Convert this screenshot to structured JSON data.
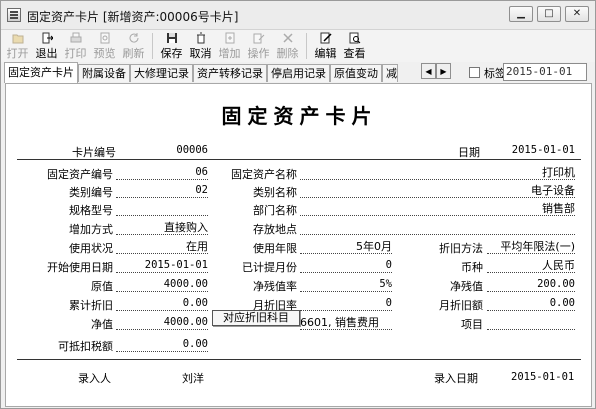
{
  "window": {
    "title": "固定资产卡片 [新增资产:00006号卡片]",
    "buttons": [
      "minimize",
      "maximize",
      "close"
    ]
  },
  "toolbar": [
    {
      "label": "打开",
      "icon": "open-icon",
      "enabled": false
    },
    {
      "label": "退出",
      "icon": "exit-icon",
      "enabled": true
    },
    {
      "label": "打印",
      "icon": "print-icon",
      "enabled": false
    },
    {
      "label": "预览",
      "icon": "preview-icon",
      "enabled": false
    },
    {
      "label": "刷新",
      "icon": "refresh-icon",
      "enabled": false
    },
    {
      "label": "保存",
      "icon": "save-icon",
      "enabled": true
    },
    {
      "label": "取消",
      "icon": "cancel-icon",
      "enabled": true
    },
    {
      "label": "增加",
      "icon": "add-icon",
      "enabled": false
    },
    {
      "label": "操作",
      "icon": "operate-icon",
      "enabled": false
    },
    {
      "label": "删除",
      "icon": "delete-icon",
      "enabled": false
    },
    {
      "label": "编辑",
      "icon": "edit-icon",
      "enabled": true
    },
    {
      "label": "查看",
      "icon": "view-icon",
      "enabled": true
    }
  ],
  "tabs": [
    "固定资产卡片",
    "附属设备",
    "大修理记录",
    "资产转移记录",
    "停启用记录",
    "原值变动",
    "减"
  ],
  "tag": {
    "label": "标签",
    "value": "2015-01-01"
  },
  "card": {
    "title": "固定资产卡片",
    "card_no_label": "卡片编号",
    "card_no": "00006",
    "date_label": "日期",
    "date": "2015-01-01",
    "fields": {
      "asset_code_label": "固定资产编号",
      "asset_code": "06",
      "asset_name_label": "固定资产名称",
      "asset_name": "打印机",
      "category_code_label": "类别编号",
      "category_code": "02",
      "category_name_label": "类别名称",
      "category_name": "电子设备",
      "spec_label": "规格型号",
      "spec": "",
      "dept_label": "部门名称",
      "dept": "销售部",
      "add_method_label": "增加方式",
      "add_method": "直接购入",
      "location_label": "存放地点",
      "location": "",
      "status_label": "使用状况",
      "status": "在用",
      "life_label": "使用年限",
      "life": "5年0月",
      "dep_method_label": "折旧方法",
      "dep_method": "平均年限法(一)",
      "start_date_label": "开始使用日期",
      "start_date": "2015-01-01",
      "months_label": "已计提月份",
      "months": "0",
      "currency_label": "币种",
      "currency": "人民币",
      "orig_label": "原值",
      "orig": "4000.00",
      "salvage_rate_label": "净残值率",
      "salvage_rate": "5%",
      "salvage_label": "净残值",
      "salvage": "200.00",
      "acc_dep_label": "累计折旧",
      "acc_dep": "0.00",
      "monthly_rate_label": "月折旧率",
      "monthly_rate": "0",
      "monthly_amt_label": "月折旧额",
      "monthly_amt": "0.00",
      "net_label": "净值",
      "net": "4000.00",
      "dep_subject_value": "6601, 销售费用",
      "project_label": "项目",
      "project": "",
      "tax_label": "可抵扣税额",
      "tax": "0.00"
    },
    "tooltip": "对应折旧科目",
    "entered_by_label": "录入人",
    "entered_by": "刘洋",
    "entry_date_label": "录入日期",
    "entry_date": "2015-01-01"
  }
}
